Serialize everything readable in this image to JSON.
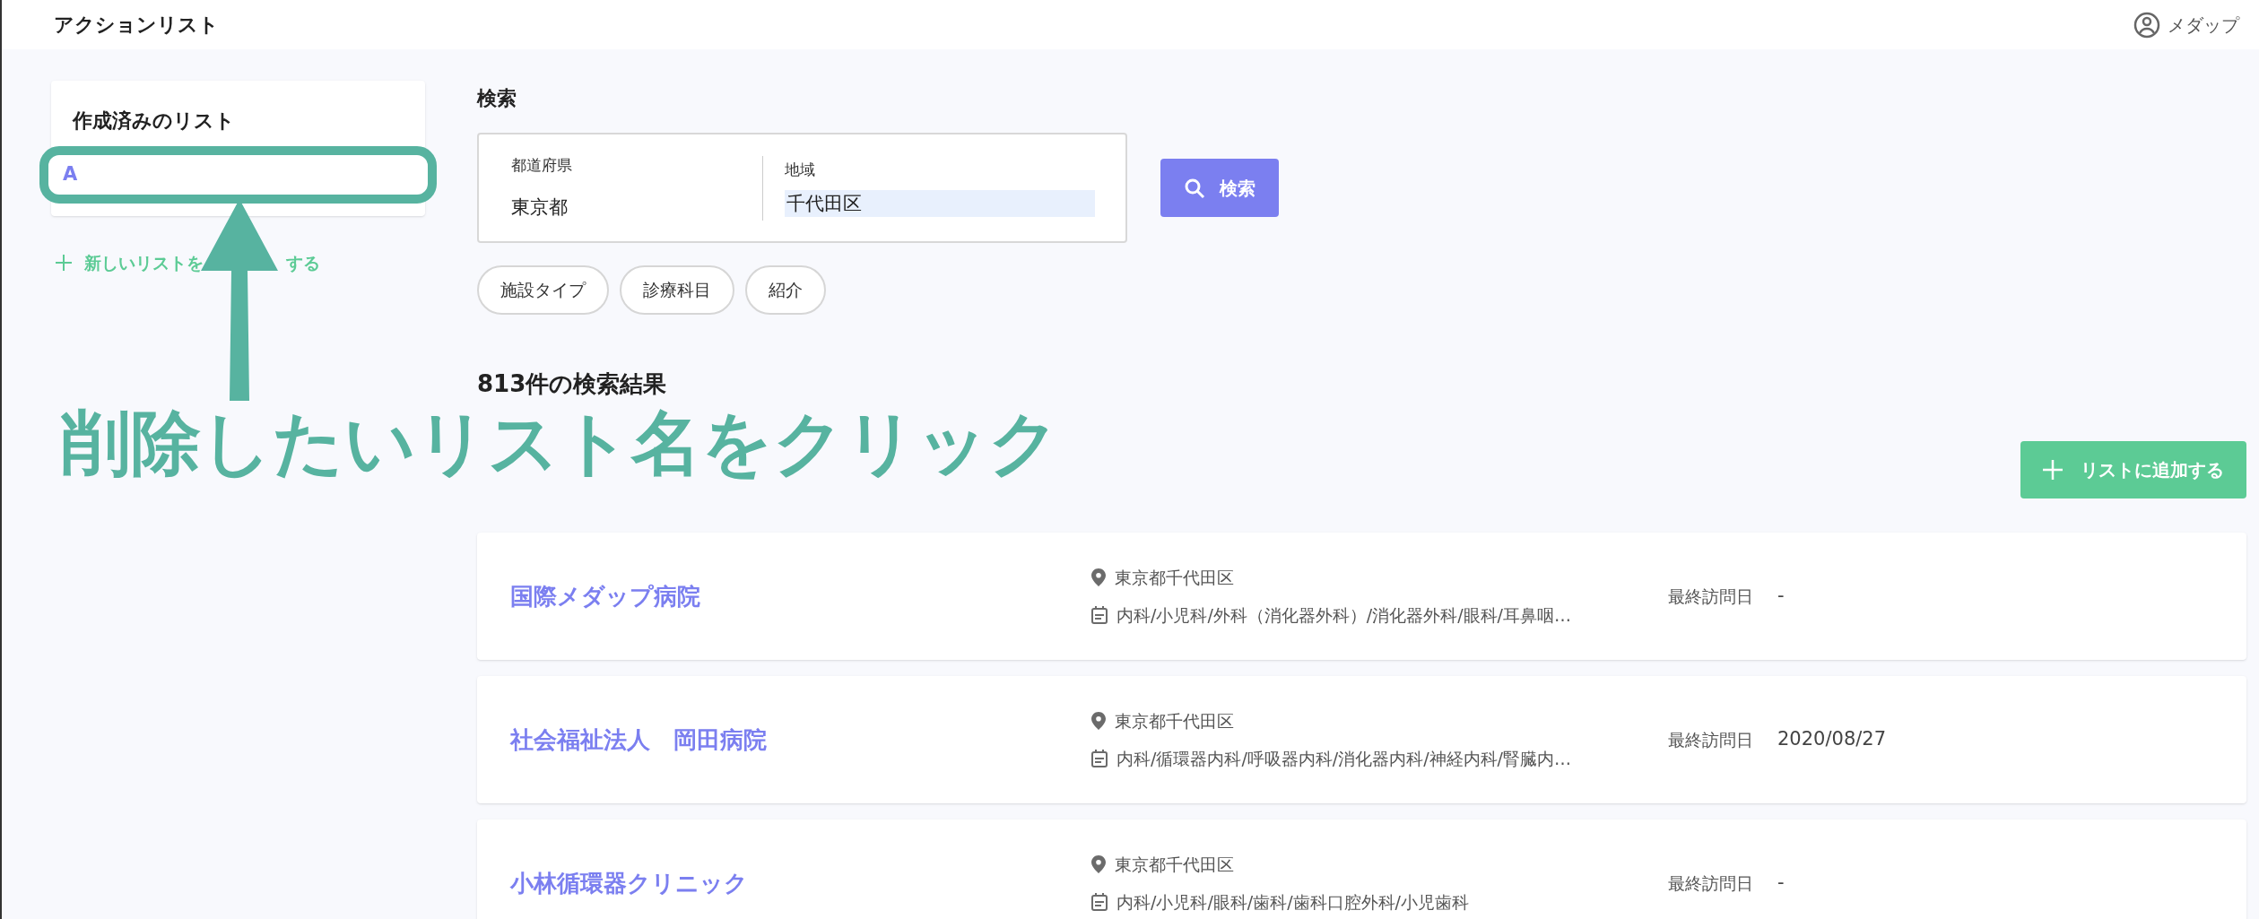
{
  "header": {
    "title": "アクションリスト",
    "user": "メダップ"
  },
  "sidebar": {
    "title": "作成済みのリスト",
    "lists": [
      {
        "label": "A",
        "selected": false
      }
    ],
    "new_list_link": {
      "text_before_arrow": "新しいリストを",
      "text_after_arrow": "する"
    }
  },
  "search": {
    "title": "検索",
    "fields": [
      {
        "label": "都道府県",
        "value": "東京都",
        "kind": "text"
      },
      {
        "label": "地域",
        "value": "千代田区",
        "kind": "input"
      }
    ],
    "button": "検索",
    "filters": [
      "施設タイプ",
      "診療科目",
      "紹介"
    ]
  },
  "results": {
    "count_label": "813件の検索結果",
    "add_button": "リストに追加する",
    "items": [
      {
        "name": "国際メダップ病院",
        "address": "東京都千代田区",
        "departments": "内科/小児科/外科（消化器外科）/消化器外科/眼科/耳鼻咽…",
        "last_visit_label": "最終訪問日",
        "last_visit": "-"
      },
      {
        "name": "社会福祉法人　岡田病院",
        "address": "東京都千代田区",
        "departments": "内科/循環器内科/呼吸器内科/消化器内科/神経内科/腎臓内…",
        "last_visit_label": "最終訪問日",
        "last_visit": "2020/08/27"
      },
      {
        "name": "小林循環器クリニック",
        "address": "東京都千代田区",
        "departments": "内科/小児科/眼科/歯科/歯科口腔外科/小児歯科",
        "last_visit_label": "最終訪問日",
        "last_visit": "-"
      }
    ]
  },
  "annotation": {
    "callout": "削除したいリスト名をクリック"
  }
}
